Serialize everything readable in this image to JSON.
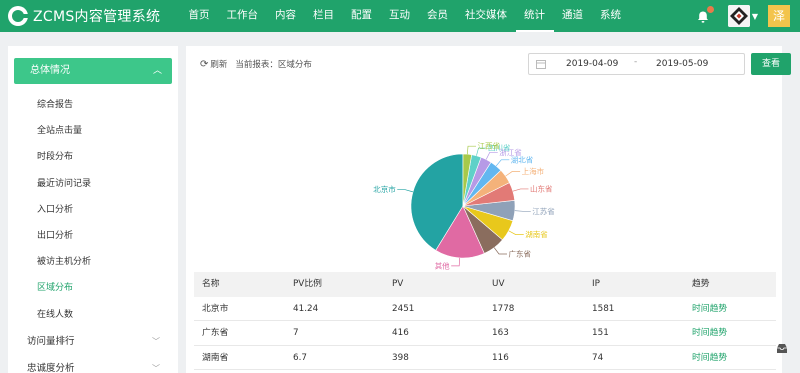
{
  "header": {
    "logo_text": "ZCMS内容管理系统",
    "nav": [
      "首页",
      "工作台",
      "内容",
      "栏目",
      "配置",
      "互动",
      "会员",
      "社交媒体",
      "统计",
      "通道",
      "系统"
    ],
    "active_nav": "统计",
    "user_badge": "泽",
    "icons": [
      "bell-icon",
      "avatar",
      "caret-down-icon"
    ]
  },
  "sidebar": {
    "group": "总体情况",
    "items": [
      "综合报告",
      "全站点击量",
      "时段分布",
      "最近访问记录",
      "入口分析",
      "出口分析",
      "被访主机分析",
      "区域分布",
      "在线人数"
    ],
    "active_item": "区域分布",
    "sections": [
      "访问量排行",
      "忠诚度分析"
    ]
  },
  "toolbar": {
    "refresh_label": "刷新",
    "report_label": "当前报表：区域分布",
    "date_start": "2019-04-09",
    "date_sep": "-",
    "date_end": "2019-05-09",
    "query_label": "查看"
  },
  "chart_data": {
    "type": "pie",
    "slices": [
      {
        "name": "北京市",
        "value": 41.24,
        "color": "#23a3a3"
      },
      {
        "name": "其他",
        "value": 15.5,
        "color": "#e06aa3"
      },
      {
        "name": "广东省",
        "value": 7,
        "color": "#8a6d5e"
      },
      {
        "name": "湖南省",
        "value": 6.7,
        "color": "#e8c81c"
      },
      {
        "name": "江苏省",
        "value": 6.3,
        "color": "#8fa1b8"
      },
      {
        "name": "山东省",
        "value": 5.7,
        "color": "#e27a76"
      },
      {
        "name": "上海市",
        "value": 4.6,
        "color": "#f4b27a"
      },
      {
        "name": "湖北省",
        "value": 3.9,
        "color": "#62b7f0"
      },
      {
        "name": "浙江省",
        "value": 3.4,
        "color": "#b69ae6"
      },
      {
        "name": "四川省",
        "value": 3.0,
        "color": "#5fd1c8"
      },
      {
        "name": "江西省",
        "value": 2.66,
        "color": "#a7c94a"
      }
    ]
  },
  "table": {
    "columns": [
      "名称",
      "PV比例",
      "PV",
      "UV",
      "IP",
      "趋势"
    ],
    "rows": [
      [
        "北京市",
        "41.24",
        "2451",
        "1778",
        "1581",
        "时间趋势"
      ],
      [
        "广东省",
        "7",
        "416",
        "163",
        "151",
        "时间趋势"
      ],
      [
        "湖南省",
        "6.7",
        "398",
        "116",
        "74",
        "时间趋势"
      ]
    ]
  }
}
